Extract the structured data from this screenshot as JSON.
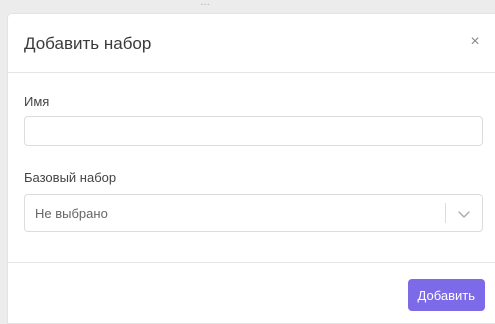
{
  "backdrop": {
    "text": "..."
  },
  "dialog": {
    "title": "Добавить набор",
    "close_symbol": "×"
  },
  "fields": {
    "name_label": "Имя",
    "name_value": "",
    "base_label": "Базовый набор",
    "base_selected": "Не выбрано"
  },
  "footer": {
    "submit_label": "Добавить"
  },
  "icons": {
    "close": "close-icon",
    "dropdown": "chevron-down-icon"
  },
  "colors": {
    "accent": "#7c6ae8"
  }
}
